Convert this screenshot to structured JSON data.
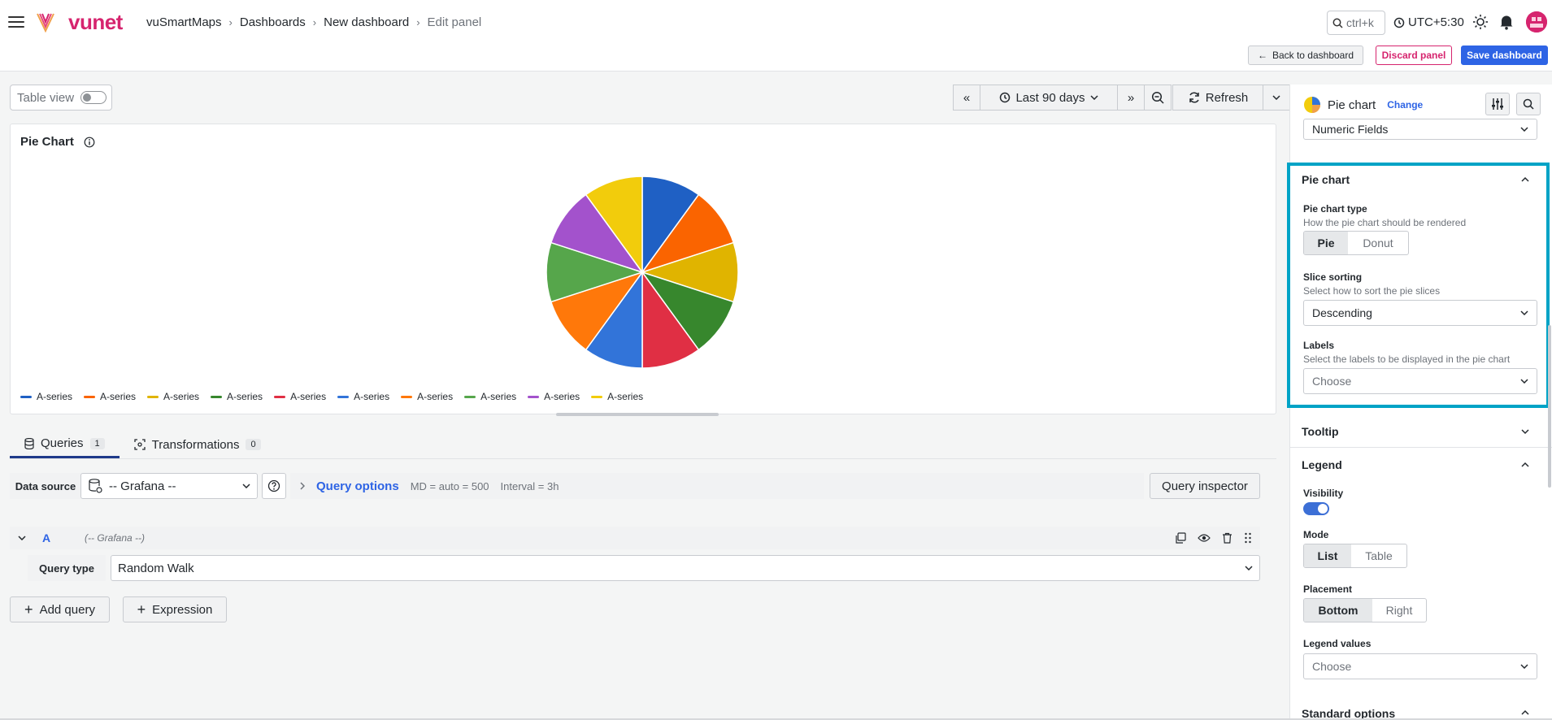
{
  "header": {
    "logo_text": "vunet",
    "breadcrumb": [
      "vuSmartMaps",
      "Dashboards",
      "New dashboard",
      "Edit panel"
    ],
    "search_shortcut": "ctrl+k",
    "timezone": "UTC+5:30"
  },
  "toolbar": {
    "back_label": "Back to dashboard",
    "discard_label": "Discard panel",
    "save_label": "Save dashboard"
  },
  "panel_controls": {
    "table_view_label": "Table view",
    "time_range": "Last 90 days",
    "refresh_label": "Refresh"
  },
  "panel": {
    "title": "Pie Chart",
    "legend": [
      "A-series",
      "A-series",
      "A-series",
      "A-series",
      "A-series",
      "A-series",
      "A-series",
      "A-series",
      "A-series",
      "A-series"
    ]
  },
  "chart_data": {
    "type": "pie",
    "title": "Pie Chart",
    "categories": [
      "A-series",
      "A-series",
      "A-series",
      "A-series",
      "A-series",
      "A-series",
      "A-series",
      "A-series",
      "A-series",
      "A-series"
    ],
    "values": [
      10,
      10,
      10,
      10,
      10,
      10,
      10,
      10,
      10,
      10
    ],
    "colors": [
      "#1f60c4",
      "#fa6400",
      "#e0b400",
      "#37872d",
      "#e02f44",
      "#3274d9",
      "#ff780a",
      "#56a64b",
      "#a352cc",
      "#f2cc0c"
    ],
    "legend": "bottom-left"
  },
  "query_tabs": [
    {
      "label": "Queries",
      "count": "1"
    },
    {
      "label": "Transformations",
      "count": "0"
    }
  ],
  "query_row": {
    "datasource_label": "Data source",
    "datasource_value": "-- Grafana --",
    "query_options_title": "Query options",
    "md_info": "MD = auto = 500",
    "interval_info": "Interval = 3h",
    "inspector_label": "Query inspector"
  },
  "query_a": {
    "letter": "A",
    "datasource": "(-- Grafana --)",
    "type_label": "Query type",
    "type_value": "Random Walk"
  },
  "add": {
    "query_label": "Add query",
    "expression_label": "Expression"
  },
  "sidebar": {
    "viz_name": "Pie chart",
    "change_label": "Change",
    "numeric_fields": "Numeric Fields",
    "pie_section": {
      "title": "Pie chart",
      "type_label": "Pie chart type",
      "type_desc": "How the pie chart should be rendered",
      "type_options": [
        "Pie",
        "Donut"
      ],
      "sort_label": "Slice sorting",
      "sort_desc": "Select how to sort the pie slices",
      "sort_value": "Descending",
      "labels_label": "Labels",
      "labels_desc": "Select the labels to be displayed in the pie chart",
      "labels_placeholder": "Choose"
    },
    "tooltip_title": "Tooltip",
    "legend_section": {
      "title": "Legend",
      "visibility_label": "Visibility",
      "mode_label": "Mode",
      "mode_options": [
        "List",
        "Table"
      ],
      "placement_label": "Placement",
      "placement_options": [
        "Bottom",
        "Right"
      ],
      "values_label": "Legend values",
      "values_placeholder": "Choose"
    },
    "standard_options_title": "Standard options"
  }
}
